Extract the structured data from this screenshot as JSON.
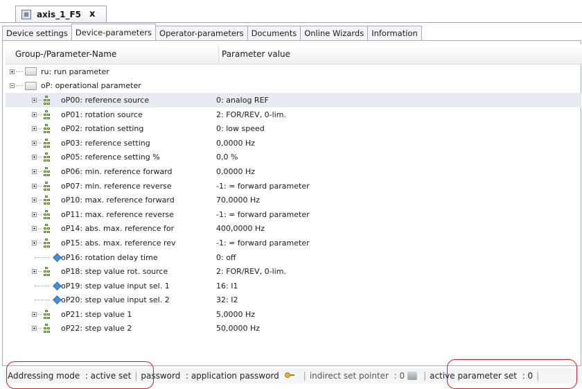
{
  "document_tab": {
    "title": "axis_1_F5",
    "close_glyph": "x"
  },
  "tabs": [
    {
      "label": "Device settings",
      "active": false
    },
    {
      "label": "Device-parameters",
      "active": true
    },
    {
      "label": "Operator-parameters",
      "active": false
    },
    {
      "label": "Documents",
      "active": false
    },
    {
      "label": "Online Wizards",
      "active": false
    },
    {
      "label": "Information",
      "active": false
    }
  ],
  "columns": {
    "name": "Group-/Parameter-Name",
    "value": "Parameter value"
  },
  "groups": [
    {
      "label": "ru: run parameter",
      "expanded": false
    },
    {
      "label": "oP: operational parameter",
      "expanded": true
    }
  ],
  "parameters": [
    {
      "name": "oP00: reference source",
      "value": "0: analog REF",
      "icon": "parameter-tree-icon"
    },
    {
      "name": "oP01: rotation source",
      "value": "2: FOR/REV, 0-lim.",
      "icon": "parameter-tree-icon"
    },
    {
      "name": "oP02: rotation setting",
      "value": "0: low speed",
      "icon": "parameter-tree-icon"
    },
    {
      "name": "oP03: reference setting",
      "value": "0,0000 Hz",
      "icon": "parameter-tree-icon"
    },
    {
      "name": "oP05: reference setting %",
      "value": "0,0 %",
      "icon": "parameter-tree-icon"
    },
    {
      "name": "oP06: min. reference forward",
      "value": "0,0000 Hz",
      "icon": "parameter-tree-icon"
    },
    {
      "name": "oP07: min. reference reverse",
      "value": "-1: = forward parameter",
      "icon": "parameter-tree-icon"
    },
    {
      "name": "oP10: max. reference forward",
      "value": "70,0000 Hz",
      "icon": "parameter-tree-icon"
    },
    {
      "name": "oP11: max. reference reverse",
      "value": "-1: = forward parameter",
      "icon": "parameter-tree-icon"
    },
    {
      "name": "oP14: abs. max. reference for",
      "value": "400,0000 Hz",
      "icon": "parameter-tree-icon"
    },
    {
      "name": "oP15: abs. max. reference rev",
      "value": "-1: = forward parameter",
      "icon": "parameter-tree-icon"
    },
    {
      "name": "oP16: rotation delay time",
      "value": "0: off",
      "icon": "parameter-leaf-icon"
    },
    {
      "name": "oP18: step value rot. source",
      "value": "2: FOR/REV, 0-lim.",
      "icon": "parameter-tree-icon"
    },
    {
      "name": "oP19: step value input sel. 1",
      "value": "16: I1",
      "icon": "parameter-leaf-icon"
    },
    {
      "name": "oP20: step value input sel. 2",
      "value": "32: I2",
      "icon": "parameter-leaf-icon"
    },
    {
      "name": "oP21: step value 1",
      "value": "5,0000 Hz",
      "icon": "parameter-tree-icon"
    },
    {
      "name": "oP22: step value 2",
      "value": "50,0000 Hz",
      "icon": "parameter-tree-icon"
    }
  ],
  "status_bar": {
    "addressing": "Addressing mode  : active set",
    "password": "password  : application password",
    "pointer": "indirect set pointer  : 0",
    "active_set": "active parameter set  : 0",
    "separator": "|"
  },
  "highlight_color": "#d0202a"
}
